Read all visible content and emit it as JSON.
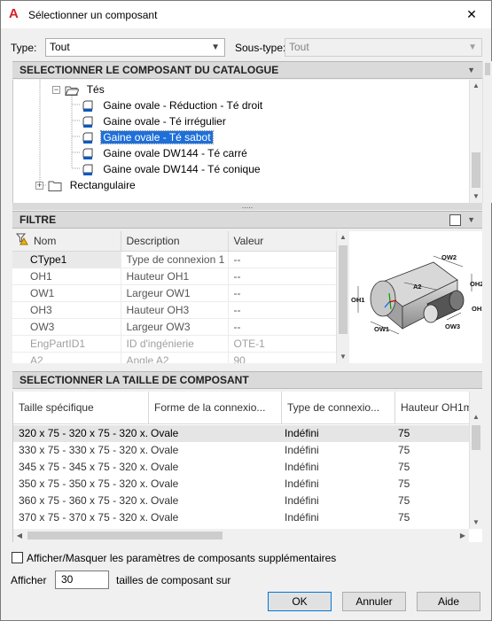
{
  "window": {
    "title": "Sélectionner un composant",
    "close_glyph": "✕",
    "app_icon": "A"
  },
  "filters": {
    "type_label": "Type:",
    "type_value": "Tout",
    "subtype_label": "Sous-type:",
    "subtype_value": "Tout"
  },
  "catalog": {
    "header": "SELECTIONNER LE COMPOSANT DU CATALOGUE",
    "tree": [
      {
        "label": "Tés",
        "kind": "folder-open"
      },
      {
        "label": "Gaine ovale - Réduction - Té droit",
        "kind": "item"
      },
      {
        "label": "Gaine ovale - Té irrégulier",
        "kind": "item"
      },
      {
        "label": "Gaine ovale - Té sabot",
        "kind": "item",
        "selected": true
      },
      {
        "label": "Gaine ovale DW144 - Té carré",
        "kind": "item"
      },
      {
        "label": "Gaine ovale DW144 - Té conique",
        "kind": "item"
      },
      {
        "label": "Rectangulaire",
        "kind": "folder"
      }
    ],
    "splitter_glyph": "....."
  },
  "filtre": {
    "header": "FILTRE",
    "columns": [
      "Nom",
      "Description",
      "Valeur"
    ],
    "rows": [
      {
        "name": "CType1",
        "desc": "Type de connexion 1",
        "value": "--"
      },
      {
        "name": "OH1",
        "desc": "Hauteur OH1",
        "value": "--"
      },
      {
        "name": "OW1",
        "desc": "Largeur OW1",
        "value": "--"
      },
      {
        "name": "OH3",
        "desc": "Hauteur OH3",
        "value": "--"
      },
      {
        "name": "OW3",
        "desc": "Largeur OW3",
        "value": "--"
      },
      {
        "name": "EngPartID1",
        "desc": "ID d'ingénierie",
        "value": "OTE-1"
      },
      {
        "name": "A2",
        "desc": "Angle A2",
        "value": "90"
      }
    ],
    "preview_labels": [
      "OW2",
      "A2",
      "OH2",
      "OH1",
      "OH3",
      "OW1",
      "OW3"
    ]
  },
  "sizes": {
    "header": "SELECTIONNER LA TAILLE DE COMPOSANT",
    "columns": [
      "Taille spécifique",
      "Forme de la connexio...",
      "Type de connexio...",
      "Hauteur OH1m"
    ],
    "rows": [
      [
        "320 x 75 - 320 x 75 - 320 x...",
        "Ovale",
        "Indéfini",
        "75"
      ],
      [
        "330 x 75 - 330 x 75 - 320 x...",
        "Ovale",
        "Indéfini",
        "75"
      ],
      [
        "345 x 75 - 345 x 75 - 320 x...",
        "Ovale",
        "Indéfini",
        "75"
      ],
      [
        "350 x 75 - 350 x 75 - 320 x...",
        "Ovale",
        "Indéfini",
        "75"
      ],
      [
        "360 x 75 - 360 x 75 - 320 x...",
        "Ovale",
        "Indéfini",
        "75"
      ],
      [
        "370 x 75 - 370 x 75 - 320 x...",
        "Ovale",
        "Indéfini",
        "75"
      ]
    ]
  },
  "footer": {
    "checkbox_label": "Afficher/Masquer les paramètres de composants supplémentaires",
    "show_label": "Afficher",
    "show_value": "30",
    "show_suffix": "tailles de composant sur",
    "ok": "OK",
    "cancel": "Annuler",
    "help": "Aide"
  },
  "colors": {
    "selection": "#1e6fd9",
    "header_bg": "#dadada",
    "app_icon": "#d4202a"
  }
}
